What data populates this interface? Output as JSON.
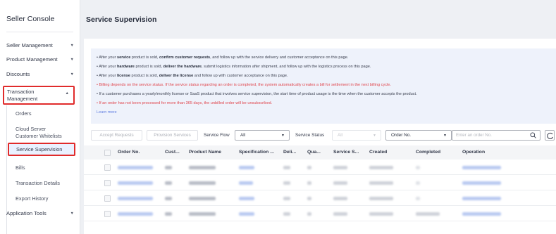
{
  "sidebar": {
    "title": "Seller Console",
    "items": [
      {
        "label": "Seller Management",
        "chevron": "chevron-down"
      },
      {
        "label": "Product Management",
        "chevron": "chevron-down"
      },
      {
        "label": "Discounts",
        "chevron": "chevron-down"
      }
    ],
    "transaction_group": {
      "line1": "Transaction",
      "line2": "Management",
      "chevron": "chevron-up"
    },
    "sub_items": {
      "orders": "Orders",
      "whitelists_line1": "Cloud Server",
      "whitelists_line2": "Customer Whitelists",
      "service_supervision": "Service Supervision",
      "bills": "Bills",
      "transaction_details": "Transaction Details",
      "export_history": "Export History"
    },
    "application_tools": {
      "label": "Application Tools",
      "chevron": "chevron-down"
    }
  },
  "header": {
    "page_title": "Service Supervision"
  },
  "notice": {
    "l1": {
      "p1": "• After your ",
      "b1": "service",
      "p2": " product is sold, ",
      "b2": "confirm customer requests",
      "p3": ", and follow up with the service delivery and customer acceptance on this page."
    },
    "l2": {
      "p1": "• After your ",
      "b1": "hardware",
      "p2": " product is sold, ",
      "b2": "deliver the hardware",
      "p3": ", submit logistics information after shipment, and follow up with the logistics process on this page."
    },
    "l3": {
      "p1": "• After your ",
      "b1": "license",
      "p2": " product is sold, ",
      "b2": "deliver the license",
      "p3": " and follow up with customer acceptance on this page."
    },
    "l4": "• Billing depends on the service status. If the service status regarding an order is completed, the system automatically creates a bill for settlement in the next billing cycle.",
    "l5": "• If a customer purchases a yearly/monthly license or SaaS product that involves service supervision, the start time of product usage is the time when the customer accepts the product.",
    "l6": "• If an order has not been processed for more than 365 days, the unbilled order will be unsubscribed.",
    "learn_more": "Learn more"
  },
  "toolbar": {
    "accept_requests": "Accept Requests",
    "provision_services": "Provision Services",
    "service_flow_label": "Service Flow",
    "service_flow_value": "All",
    "service_status_label": "Service Status",
    "service_status_value": "All",
    "search_field_value": "Order No.",
    "search_placeholder": "Enter an order No."
  },
  "table": {
    "columns": [
      "Order No.",
      "Cust...",
      "Product Name",
      "Specification ...",
      "Deli...",
      "Qua...",
      "Service S...",
      "Created",
      "Completed",
      "Operation"
    ]
  },
  "colors": {
    "accent": "#5e7ce0",
    "highlight_border": "#e02b2b",
    "warning_text": "#e0454c"
  }
}
